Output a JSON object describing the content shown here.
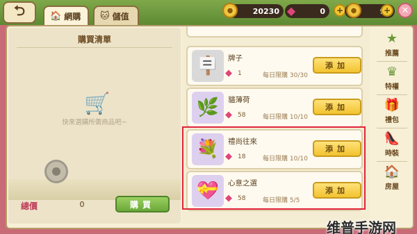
{
  "tabs": {
    "shop": {
      "label": "網購",
      "icon": "house-icon"
    },
    "topup": {
      "label": "儲值",
      "icon": "cat-icon"
    }
  },
  "currency": {
    "coins": "20230",
    "gems": "0",
    "gold": "90"
  },
  "cart": {
    "title": "購買清單",
    "empty_hint": "快來選購所需商品吧~",
    "total_label": "總價",
    "total_value": "0",
    "buy_label": "購買"
  },
  "items": [
    {
      "name": "牌子",
      "price": "1",
      "limit": "每日限購 30/30",
      "add_label": "添加",
      "icon": "sign-icon"
    },
    {
      "name": "貓薄荷",
      "price": "58",
      "limit": "每日限購 10/10",
      "add_label": "添加",
      "icon": "catnip-icon"
    },
    {
      "name": "禮尚往來",
      "price": "18",
      "limit": "每日限購 10/10",
      "add_label": "添加",
      "icon": "gift-bouquet-icon"
    },
    {
      "name": "心意之選",
      "price": "58",
      "limit": "每日限購 5/5",
      "add_label": "添加",
      "icon": "heart-bouquet-icon"
    }
  ],
  "nav": [
    {
      "label": "推薦",
      "icon": "star-icon"
    },
    {
      "label": "特權",
      "icon": "crown-icon"
    },
    {
      "label": "禮包",
      "icon": "gift-icon"
    },
    {
      "label": "時裝",
      "icon": "shoe-icon"
    },
    {
      "label": "房屋",
      "icon": "house-icon"
    }
  ],
  "watermark": "维普手游网",
  "colors": {
    "accent_green": "#6aa83a",
    "add_yellow": "#f2c330",
    "highlight_red": "#e0243a",
    "gem_pink": "#e0457a"
  }
}
